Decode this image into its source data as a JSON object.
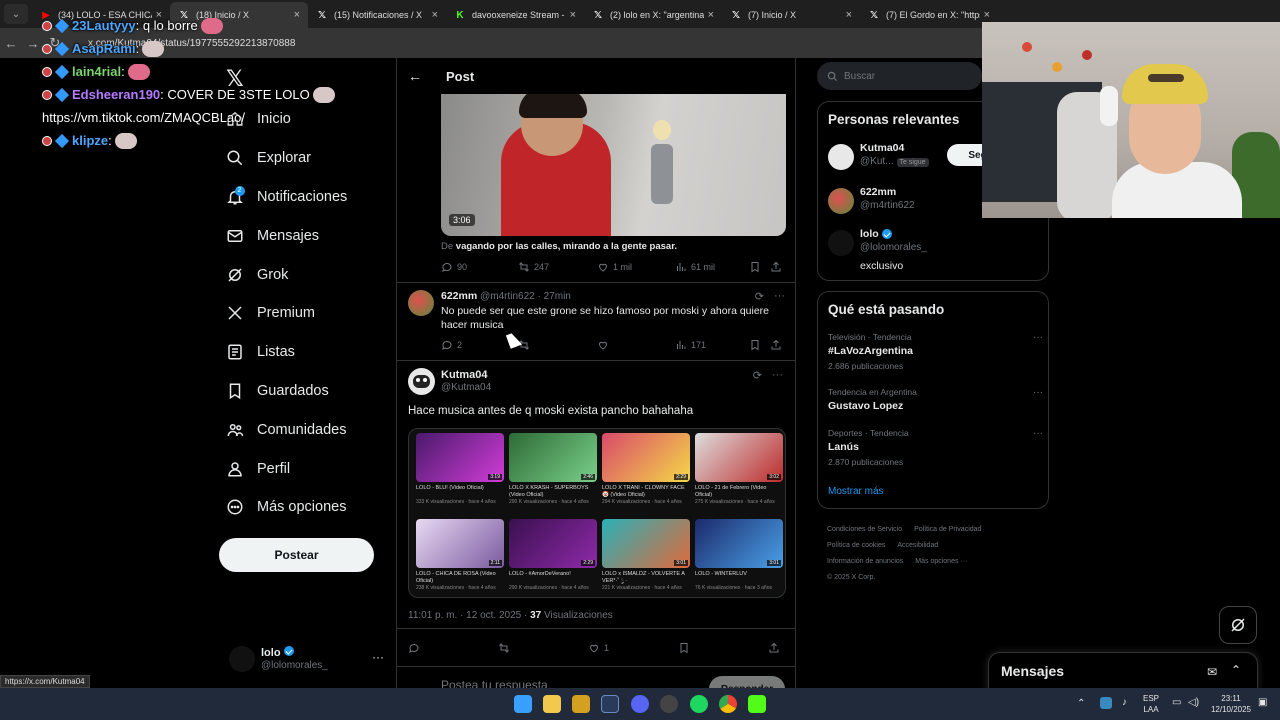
{
  "browser": {
    "tabs": [
      {
        "label": "(34) LOLO - ESA CHICA SA",
        "icon": "youtube-icon",
        "color": "#ff0000"
      },
      {
        "label": "(18) Inicio / X",
        "icon": "x-icon",
        "color": "#ffffff"
      },
      {
        "label": "(15) Notificaciones / X",
        "icon": "x-icon",
        "color": "#ffffff"
      },
      {
        "label": "davooxeneize Stream - W",
        "icon": "kick-icon",
        "color": "#53fc18"
      },
      {
        "label": "(2) lolo en X: \"argentina m",
        "icon": "x-icon",
        "color": "#ffffff"
      },
      {
        "label": "(7) Inicio / X",
        "icon": "x-icon",
        "color": "#ffffff"
      },
      {
        "label": "(7) El Gordo en X: \"https",
        "icon": "x-icon",
        "color": "#ffffff"
      }
    ],
    "url": "x.com/Kutma04/status/1977555292213870888",
    "status_url": "https://x.com/Kutma04"
  },
  "chat": [
    {
      "user": "23Lautyyy",
      "text": ": q lo borre",
      "color": "#4da6ff"
    },
    {
      "user": "AsapRami",
      "text": ":",
      "color": "#4da6ff"
    },
    {
      "user": "lain4rial",
      "text": ":",
      "color": "#7bd46f"
    },
    {
      "user": "Edsheeran190",
      "text": ": COVER DE 3STE LOLO",
      "color": "#b57cff"
    },
    {
      "user": "",
      "text": "https://vm.tiktok.com/ZMAQCBLao/",
      "color": "#ffffff"
    },
    {
      "user": "klipze",
      "text": ":",
      "color": "#4da6ff"
    }
  ],
  "nav": {
    "items": [
      {
        "label": "Inicio",
        "icon": "home-icon"
      },
      {
        "label": "Explorar",
        "icon": "search-icon"
      },
      {
        "label": "Notificaciones",
        "icon": "bell-icon",
        "badge": "2"
      },
      {
        "label": "Mensajes",
        "icon": "mail-icon"
      },
      {
        "label": "Grok",
        "icon": "grok-icon"
      },
      {
        "label": "Premium",
        "icon": "x-icon"
      },
      {
        "label": "Listas",
        "icon": "list-icon"
      },
      {
        "label": "Guardados",
        "icon": "bookmark-icon"
      },
      {
        "label": "Comunidades",
        "icon": "people-icon"
      },
      {
        "label": "Perfil",
        "icon": "person-icon"
      },
      {
        "label": "Más opciones",
        "icon": "more-circle-icon"
      }
    ],
    "post_button": "Postear",
    "account": {
      "name": "lolo",
      "handle": "@lolomorales_",
      "more": "···"
    }
  },
  "post_header": {
    "title": "Post"
  },
  "embed": {
    "duration": "3:06",
    "caption_prefix": "De",
    "caption": "vagando por las calles, mirando a la gente pasar.",
    "replies": "90",
    "reposts": "247",
    "likes": "1 mil",
    "views": "61 mil"
  },
  "reply": {
    "name": "622mm",
    "handle_time": "@m4rtin622 · 27min",
    "text": "No puede ser que este grone se hizo famoso por moski y ahora quiere hacer musica",
    "replies": "2",
    "views": "171"
  },
  "main_post": {
    "name": "Kutma04",
    "handle": "@Kutma04",
    "text": "Hace musica antes de q moski exista pancho bahahaha",
    "timestamp": "11:01 p. m. · 12 oct. 2025 ·",
    "views_count": "37",
    "views_label": "Visualizaciones",
    "likes": "1",
    "reply_placeholder": "Postea tu respuesta",
    "reply_button": "Responder",
    "videos": [
      {
        "title": "LOLO - BLU! (Video Oficial)",
        "meta": "333 K visualizaciones · hace 4 años",
        "dur": "3:19",
        "c1": "#4a1a6b",
        "c2": "#d13cd8"
      },
      {
        "title": "LOLO X KRASH - SUPERBOYS (Video Oficial)",
        "meta": "290 K visualizaciones · hace 4 años",
        "dur": "2:46",
        "c1": "#2d6a35",
        "c2": "#7ad08a"
      },
      {
        "title": "LOLO X TRANI - CLOWNY FACE 🤡 (Video Oficial)",
        "meta": "294 K visualizaciones · hace 4 años",
        "dur": "2:29",
        "c1": "#d84a6a",
        "c2": "#f6d848"
      },
      {
        "title": "LOLO - 21 de Febrero (Video Oficial)",
        "meta": "275 K visualizaciones · hace 4 años",
        "dur": "3:02",
        "c1": "#dddddd",
        "c2": "#bd2b2b"
      },
      {
        "title": "LOLO - CHICA DE ROSA (Video Oficial)",
        "meta": "238 K visualizaciones · hace 4 años",
        "dur": "2:11",
        "c1": "#e8d9f2",
        "c2": "#7a5aa0"
      },
      {
        "title": "LOLO - #AmorDeVerano!",
        "meta": "290 K visualizaciones · hace 4 años",
        "dur": "2:29",
        "c1": "#3a1050",
        "c2": "#8e2aa8"
      },
      {
        "title": "LOLO x ISMALDZ - VOLVERTE A VER*·˚ ༘ ·",
        "meta": "221 K visualizaciones · hace 4 años",
        "dur": "3:01",
        "c1": "#2ab0b8",
        "c2": "#e06a3a"
      },
      {
        "title": "LOLO - WINTERLUV",
        "meta": "76 K visualizaciones · hace 3 años",
        "dur": "3:01",
        "c1": "#1c2a6a",
        "c2": "#4aa0e8"
      }
    ]
  },
  "right": {
    "search_placeholder": "Buscar",
    "relevant_title": "Personas relevantes",
    "people": [
      {
        "name": "Kutma04",
        "handle": "@Kut...",
        "tag": "Te sigue",
        "button": "Seguir t"
      },
      {
        "name": "622mm",
        "handle": "@m4rtin622"
      },
      {
        "name": "lolo",
        "handle": "@lolomorales_",
        "bio": "exclusivo"
      }
    ],
    "trends_title": "Qué está pasando",
    "trends": [
      {
        "context": "Televisión · Tendencia",
        "name": "#LaVozArgentina",
        "count": "2.686 publicaciones"
      },
      {
        "context": "Tendencia en Argentina",
        "name": "Gustavo Lopez",
        "count": ""
      },
      {
        "context": "Deportes · Tendencia",
        "name": "Lanús",
        "count": "2.870 publicaciones"
      }
    ],
    "show_more": "Mostrar más",
    "footer": [
      "Condiciones de Servicio",
      "Política de Privacidad",
      "Política de cookies",
      "Accesibilidad",
      "Información de anuncios",
      "Más opciones ···",
      "© 2025 X Corp."
    ]
  },
  "messages_dock": {
    "title": "Mensajes"
  },
  "taskbar": {
    "lang1": "ESP",
    "lang2": "LAA",
    "time": "23:11",
    "date": "12/10/2025"
  },
  "colors": {
    "accent": "#1d9bf0",
    "bg": "#000000",
    "border": "#2f3336",
    "muted": "#71767b"
  }
}
